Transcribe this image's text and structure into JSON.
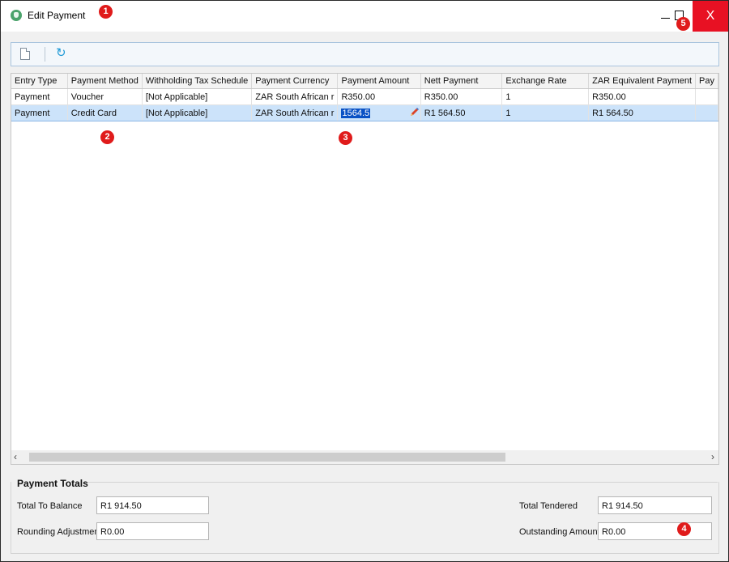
{
  "window": {
    "title": "Edit Payment",
    "markers": [
      "1",
      "2",
      "3",
      "4",
      "5"
    ],
    "close_symbol": "X"
  },
  "toolbar": {
    "items": [
      {
        "icon": "new-document-icon"
      },
      {
        "icon": "refresh-icon"
      }
    ]
  },
  "grid": {
    "columns": [
      "Entry Type",
      "Payment Method",
      "Withholding Tax Schedule",
      "Payment Currency",
      "Payment Amount",
      "Nett Payment",
      "Exchange Rate",
      "ZAR Equivalent Payment",
      "Pay"
    ],
    "rows": [
      {
        "entry_type": "Payment",
        "payment_method": "Voucher",
        "withholding": "[Not Applicable]",
        "currency": "ZAR South African r",
        "amount": "R350.00",
        "nett": "R350.00",
        "exchange": "1",
        "zar": "R350.00",
        "pay": ""
      },
      {
        "entry_type": "Payment",
        "payment_method": "Credit Card",
        "withholding": "[Not Applicable]",
        "currency": "ZAR South African r",
        "amount": "1564.5",
        "nett": "R1 564.50",
        "exchange": "1",
        "zar": "R1 564.50",
        "pay": "",
        "selected": true,
        "editing_column": "amount"
      }
    ]
  },
  "totals": {
    "section_label": "Payment Totals",
    "total_to_balance_label": "Total To Balance",
    "total_to_balance_value": "R1 914.50",
    "rounding_label": "Rounding Adjustment",
    "rounding_value": "R0.00",
    "total_tendered_label": "Total Tendered",
    "total_tendered_value": "R1 914.50",
    "outstanding_label": "Outstanding Amount",
    "outstanding_value": "R0.00"
  },
  "colors": {
    "accent": "#0a52c5",
    "selection": "#cce3fa",
    "close_button": "#e81123",
    "marker": "#e01b1b"
  }
}
